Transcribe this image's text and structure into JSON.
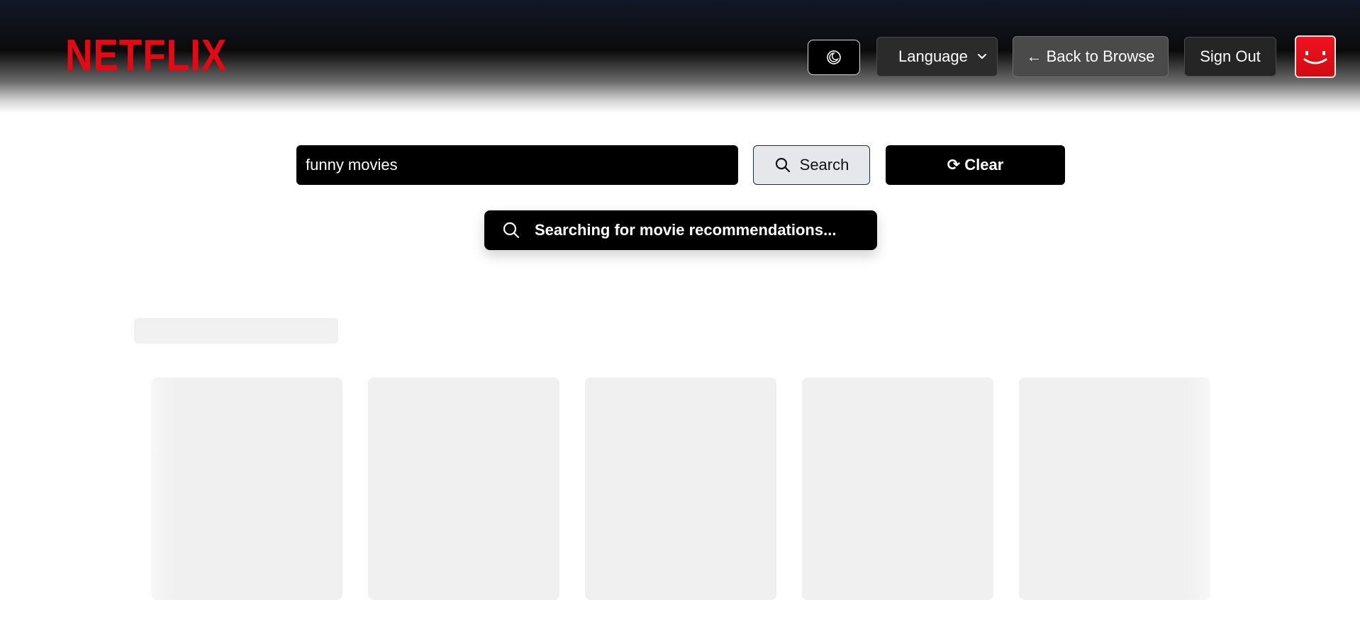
{
  "header": {
    "logo_text": "NETFLIX",
    "theme_toggle_icon": "moon-icon",
    "language_select": {
      "selected": "Language"
    },
    "back_button_label": "← Back to Browse",
    "signout_button_label": "Sign Out",
    "avatar_icon": "smiley-avatar-icon"
  },
  "search": {
    "input_value": "funny movies",
    "search_button_label": "Search",
    "search_icon": "search-icon",
    "clear_button_label": "⟳ Clear"
  },
  "status": {
    "icon": "search-icon",
    "message": "Searching for movie recommendations..."
  },
  "colors": {
    "brand_red": "#e50914",
    "black": "#000000",
    "skeleton": "#f0f0f0"
  }
}
